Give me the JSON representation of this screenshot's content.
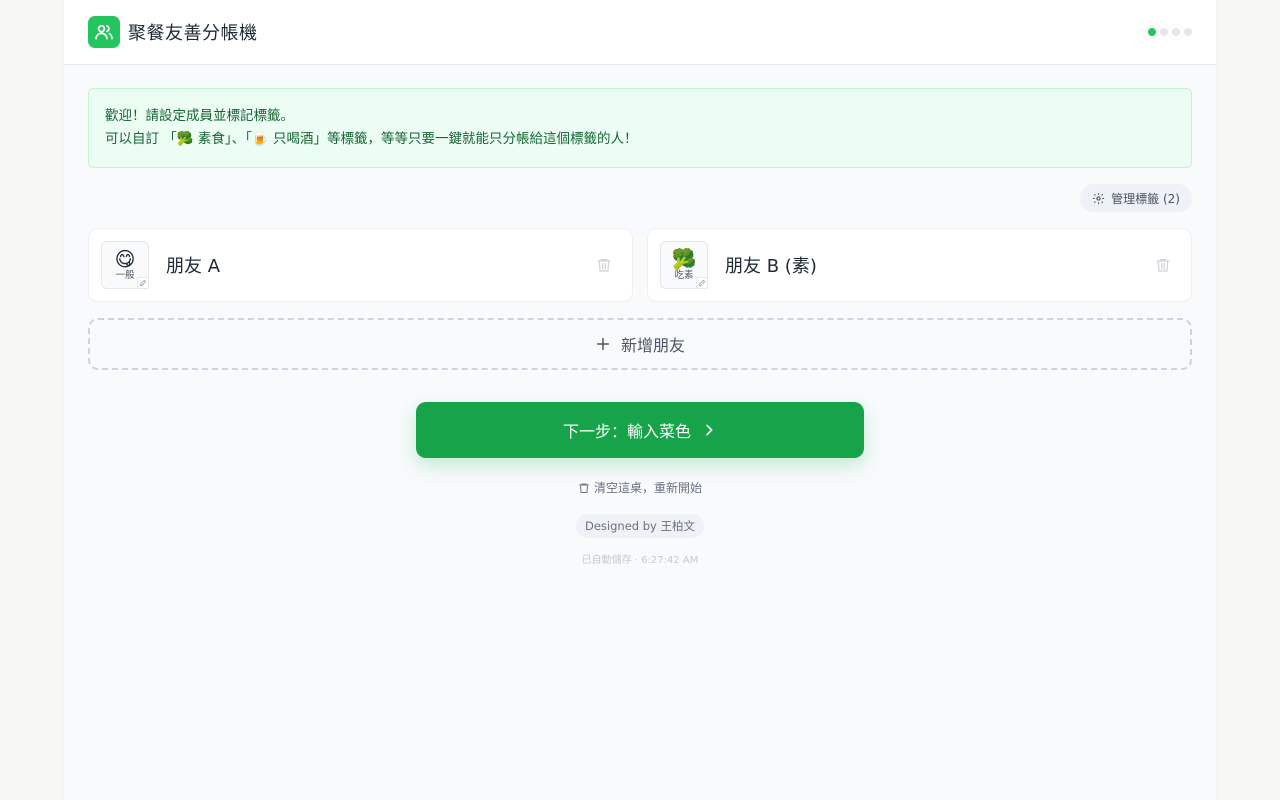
{
  "header": {
    "title": "聚餐友善分帳機",
    "steps": [
      true,
      false,
      false,
      false
    ]
  },
  "welcome": {
    "line1": "歡迎！請設定成員並標記標籤。",
    "line2": "可以自訂 「🥦 素食」、「🍺 只喝酒」等標籤，等等只要一鍵就能只分帳給這個標籤的人！"
  },
  "tags": {
    "manage_label": "管理標籤 (2)"
  },
  "friends": [
    {
      "name": "朋友 A",
      "emoji": "😋",
      "tag": "一般"
    },
    {
      "name": "朋友 B (素)",
      "emoji": "🥦",
      "tag": "吃素"
    }
  ],
  "actions": {
    "add_friend": "新增朋友",
    "next": "下一步：輸入菜色",
    "reset": "清空這桌，重新開始"
  },
  "footer": {
    "credit": "Designed by 王柏文",
    "autosave": "已自動儲存 · 6:27:42 AM"
  },
  "colors": {
    "accent": "#16a34a",
    "logo": "#22c55e",
    "welcome_bg": "#ecfdf3"
  }
}
